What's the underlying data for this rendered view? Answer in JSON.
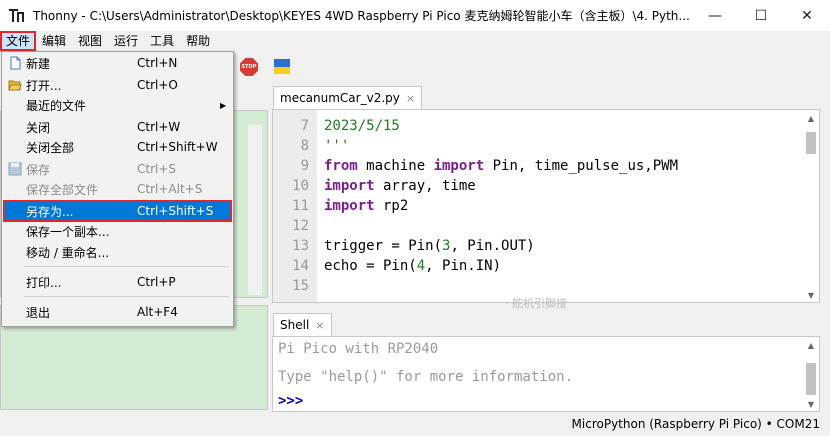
{
  "window": {
    "app_name": "Thonny",
    "title_path": "C:\\Users\\Administrator\\Desktop\\KEYES 4WD Raspberry Pi Pico 麦克纳姆轮智能小车（含主板）\\4. Pyth...",
    "minimize": "—",
    "maximize": "☐",
    "close": "✕"
  },
  "menubar": {
    "items": [
      "文件",
      "编辑",
      "视图",
      "运行",
      "工具",
      "帮助"
    ],
    "active": "文件"
  },
  "toolbar": {
    "stop_label": "STOP"
  },
  "editor": {
    "tab_label": "mecanumCar_v2.py",
    "tab_close": "×",
    "lines": [
      {
        "no": "7",
        "text": "2023/5/15"
      },
      {
        "no": "8",
        "text": "'''"
      },
      {
        "no": "9",
        "text": "from machine import Pin, time_pulse_us,PWM"
      },
      {
        "no": "10",
        "text": "import array, time"
      },
      {
        "no": "11",
        "text": "import rp2"
      },
      {
        "no": "12",
        "text": ""
      },
      {
        "no": "13",
        "text": "trigger = Pin(3, Pin.OUT)"
      },
      {
        "no": "14",
        "text": "echo = Pin(4, Pin.IN)"
      },
      {
        "no": "15",
        "text": ""
      }
    ],
    "faded_text": "· 舵机引脚接"
  },
  "shell": {
    "tab_label": "Shell",
    "tab_close": "×",
    "line1": "Pi Pico with RP2040",
    "line2": "Type \"help()\" for more information.",
    "prompt": ">>>"
  },
  "statusbar": {
    "text": "MicroPython (Raspberry Pi Pico)  •  COM21"
  },
  "file_menu": {
    "items": [
      {
        "label": "新建",
        "shortcut": "Ctrl+N",
        "icon": "new-file-icon",
        "disabled": false
      },
      {
        "label": "打开...",
        "shortcut": "Ctrl+O",
        "icon": "open-folder-icon",
        "disabled": false
      },
      {
        "label": "最近的文件",
        "shortcut": "",
        "icon": "",
        "disabled": false,
        "submenu": true
      },
      {
        "label": "关闭",
        "shortcut": "Ctrl+W",
        "icon": "",
        "disabled": false
      },
      {
        "label": "关闭全部",
        "shortcut": "Ctrl+Shift+W",
        "icon": "",
        "disabled": false
      },
      {
        "label": "保存",
        "shortcut": "Ctrl+S",
        "icon": "save-icon",
        "disabled": true
      },
      {
        "label": "保存全部文件",
        "shortcut": "Ctrl+Alt+S",
        "icon": "",
        "disabled": true
      },
      {
        "label": "另存为...",
        "shortcut": "Ctrl+Shift+S",
        "icon": "",
        "disabled": false,
        "highlighted": true
      },
      {
        "label": "保存一个副本...",
        "shortcut": "",
        "icon": "",
        "disabled": false
      },
      {
        "label": "移动 / 重命名...",
        "shortcut": "",
        "icon": "",
        "disabled": false
      },
      {
        "label": "打印...",
        "shortcut": "Ctrl+P",
        "icon": "",
        "disabled": false
      },
      {
        "label": "退出",
        "shortcut": "Alt+F4",
        "icon": "",
        "disabled": false
      }
    ]
  },
  "colors": {
    "highlight": "#0078d7",
    "annotation_red": "#e0262f",
    "file_pane": "#d4ecd4"
  }
}
